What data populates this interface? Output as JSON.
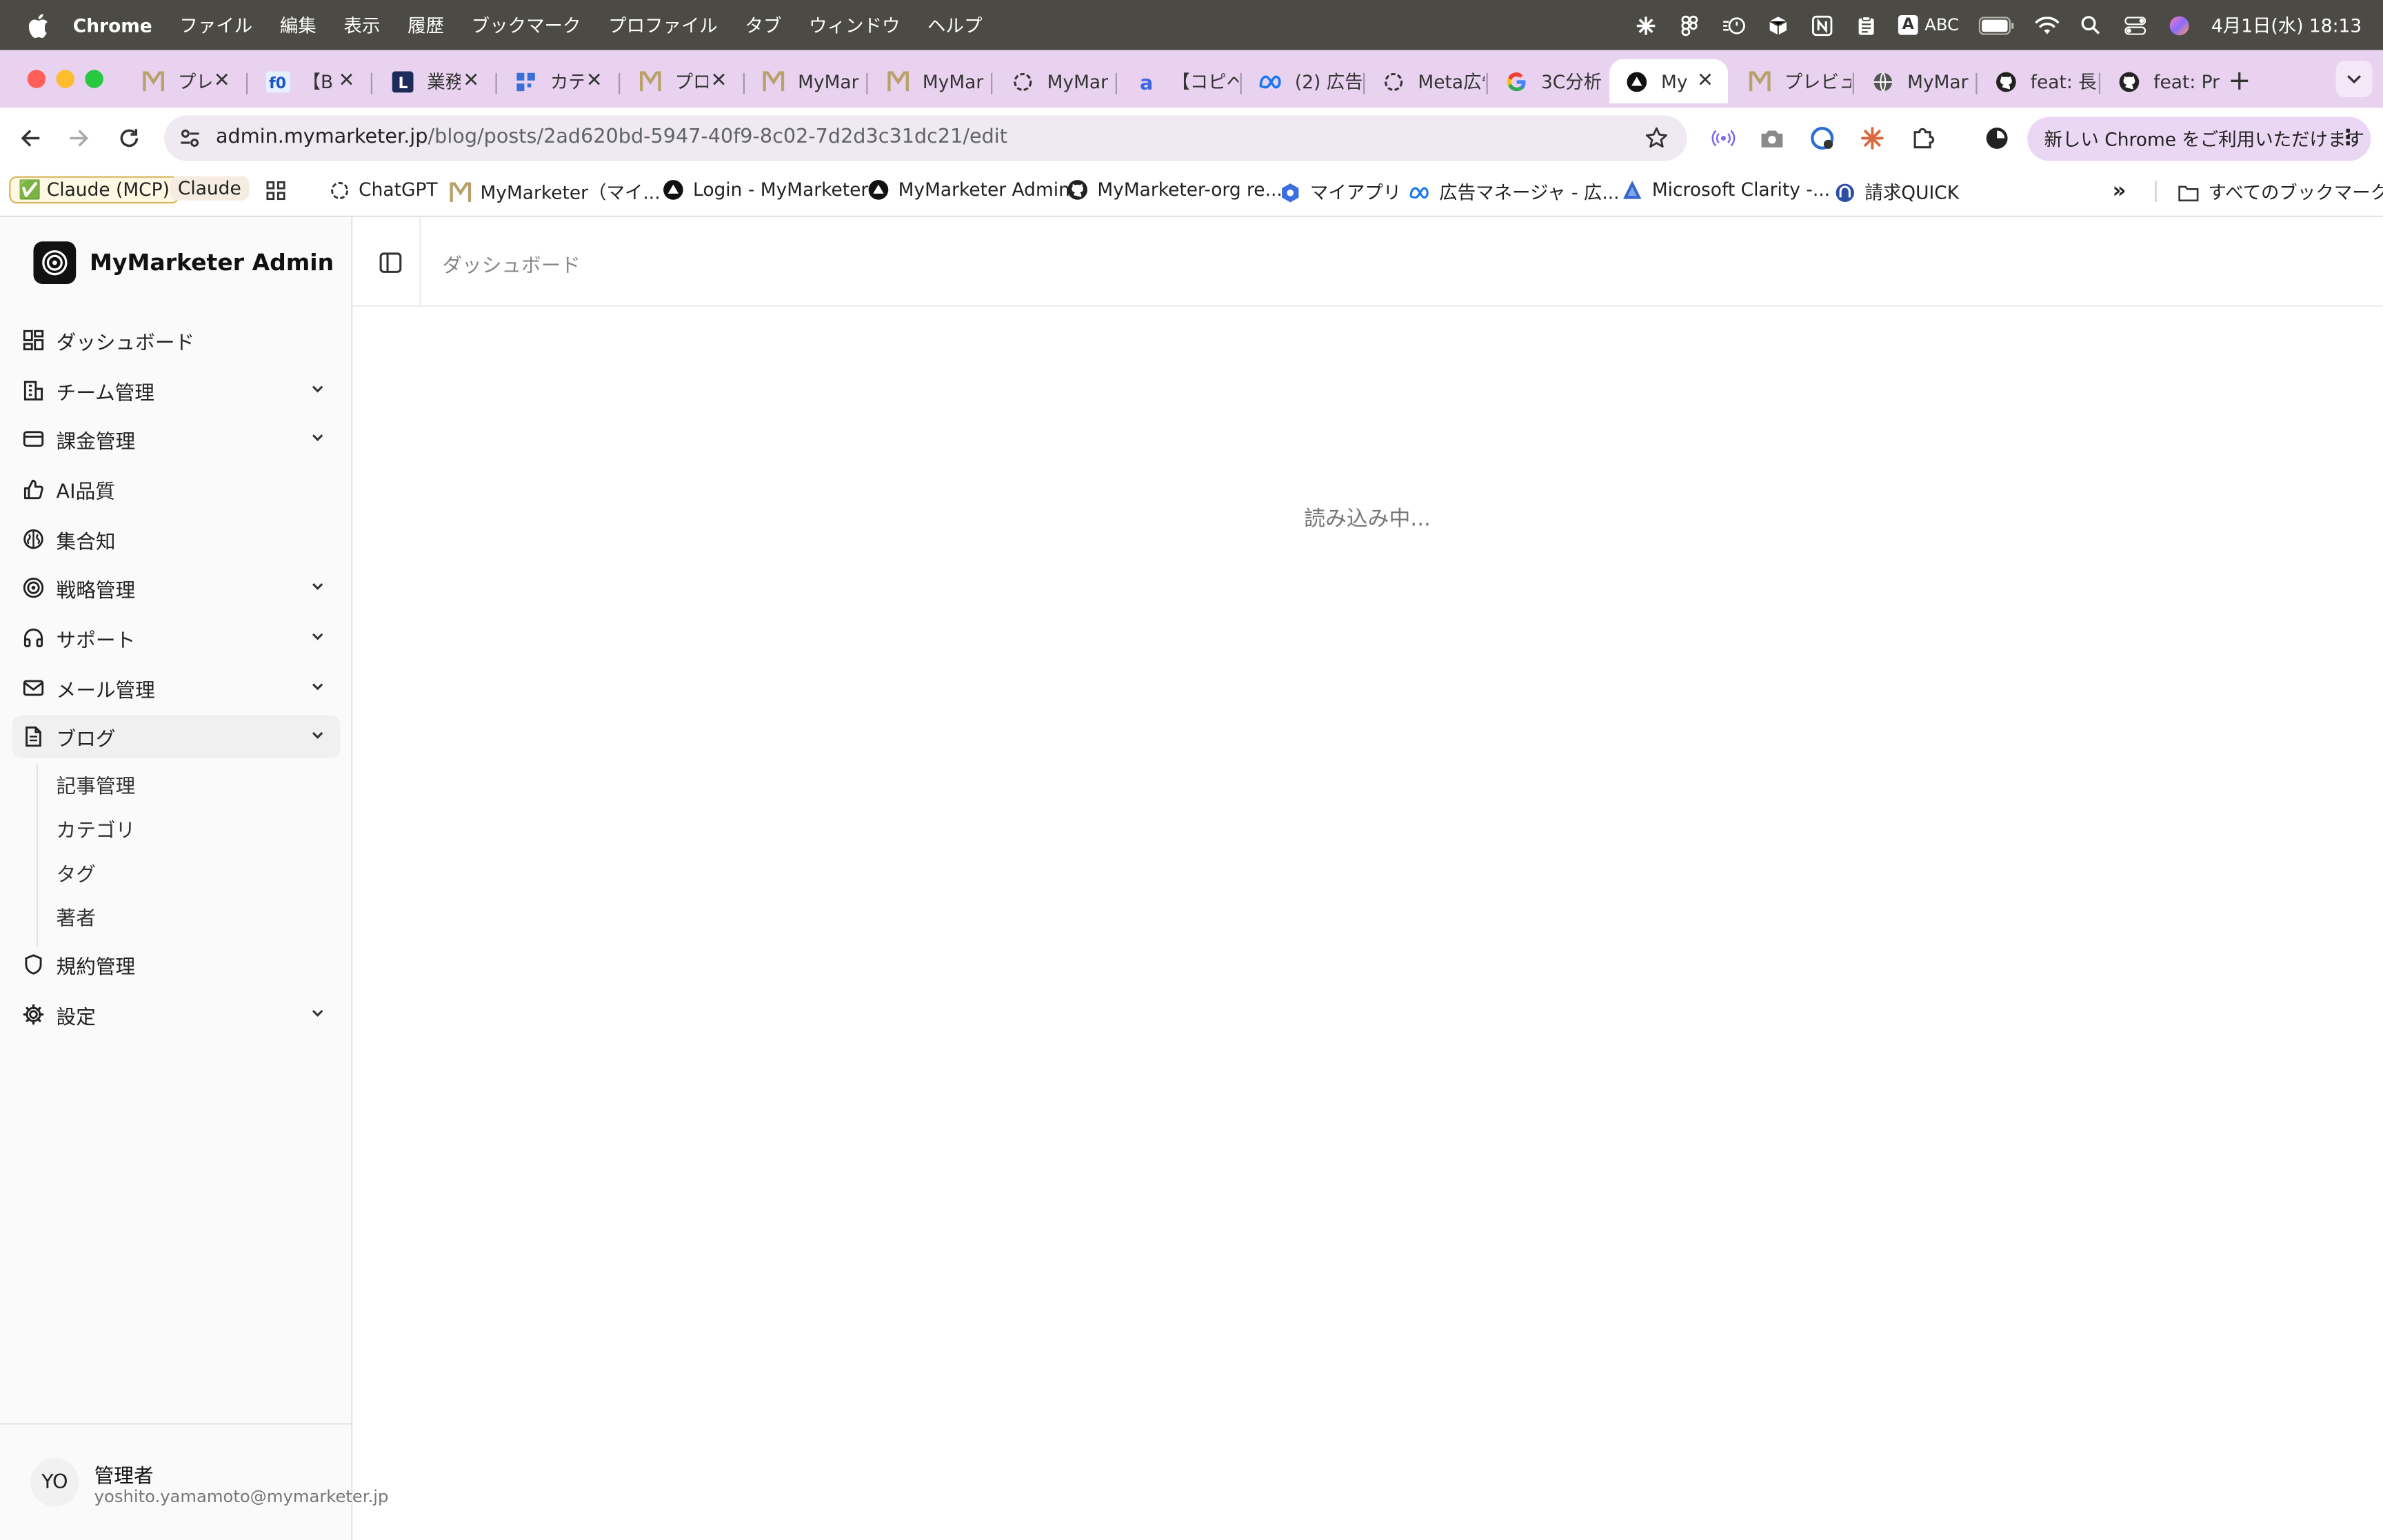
{
  "menubar": {
    "app": "Chrome",
    "items": [
      "ファイル",
      "編集",
      "表示",
      "履歴",
      "ブックマーク",
      "プロファイル",
      "タブ",
      "ウィンドウ",
      "ヘルプ"
    ],
    "input_abc": "ABC",
    "input_a": "A",
    "clock": "4月1日(水) 18:13"
  },
  "tabs": [
    {
      "title": "プレ",
      "icon": "mymarketer-logo-icon",
      "closable": true
    },
    {
      "title": "【B",
      "icon": "f-logo-icon",
      "closable": true
    },
    {
      "title": "業務",
      "icon": "l-logo-icon",
      "closable": true
    },
    {
      "title": "カテ",
      "icon": "grid-logo-icon",
      "closable": true
    },
    {
      "title": "プロ",
      "icon": "mymarketer-logo-icon",
      "closable": true
    },
    {
      "title": "MyMar",
      "icon": "mymarketer-logo-icon",
      "closable": false
    },
    {
      "title": "MyMar",
      "icon": "mymarketer-logo-icon",
      "closable": false
    },
    {
      "title": "MyMar",
      "icon": "openai-icon",
      "closable": false
    },
    {
      "title": "【コピペ",
      "icon": "a-logo-icon",
      "closable": false
    },
    {
      "title": "(2) 広告",
      "icon": "meta-icon",
      "closable": false
    },
    {
      "title": "Meta広告",
      "icon": "openai-icon",
      "closable": false
    },
    {
      "title": "3C分析",
      "icon": "google-icon",
      "closable": false
    },
    {
      "title": "My",
      "icon": "vercel-icon",
      "closable": true,
      "active": true
    },
    {
      "title": "プレビュ",
      "icon": "mymarketer-logo-icon",
      "closable": false
    },
    {
      "title": "MyMar",
      "icon": "globe-icon",
      "closable": false
    },
    {
      "title": "feat: 長",
      "icon": "github-icon",
      "closable": false
    },
    {
      "title": "feat: Pr",
      "icon": "github-icon",
      "closable": false
    }
  ],
  "address": {
    "host": "admin.mymarketer.jp",
    "path": "/blog/posts/2ad620bd-5947-40f9-8c02-7d2d3c31dc21/edit"
  },
  "chrome_update": "新しい Chrome をご利用いただけます",
  "bookmarks": [
    {
      "label": "✅ Claude (MCP)",
      "icon": ""
    },
    {
      "label": "Claude",
      "icon": ""
    },
    {
      "label": "",
      "icon": "apps-grid-icon"
    },
    {
      "label": "ChatGPT",
      "icon": "openai-icon"
    },
    {
      "label": "MyMarketer（マイ...",
      "icon": "mymarketer-logo-icon"
    },
    {
      "label": "Login - MyMarketer",
      "icon": "vercel-icon"
    },
    {
      "label": "MyMarketer Admin",
      "icon": "vercel-icon"
    },
    {
      "label": "MyMarketer-org re...",
      "icon": "github-icon"
    },
    {
      "label": "マイアプリ",
      "icon": "hex-icon"
    },
    {
      "label": "広告マネージャ - 広...",
      "icon": "meta-icon"
    },
    {
      "label": "Microsoft Clarity -...",
      "icon": "clarity-icon"
    },
    {
      "label": "請求QUICK",
      "icon": "quick-icon"
    }
  ],
  "bookmarks_all": "すべてのブックマーク",
  "brand": "MyMarketer Admin",
  "nav": [
    {
      "label": "ダッシュボード",
      "icon": "dashboard-icon",
      "expandable": false
    },
    {
      "label": "チーム管理",
      "icon": "building-icon",
      "expandable": true
    },
    {
      "label": "課金管理",
      "icon": "credit-card-icon",
      "expandable": true
    },
    {
      "label": "AI品質",
      "icon": "thumbs-up-icon",
      "expandable": false
    },
    {
      "label": "集合知",
      "icon": "brain-icon",
      "expandable": false
    },
    {
      "label": "戦略管理",
      "icon": "target-icon",
      "expandable": true
    },
    {
      "label": "サポート",
      "icon": "headphones-icon",
      "expandable": true
    },
    {
      "label": "メール管理",
      "icon": "mail-icon",
      "expandable": true
    },
    {
      "label": "ブログ",
      "icon": "file-text-icon",
      "expandable": true,
      "open": true
    },
    {
      "label": "規約管理",
      "icon": "shield-icon",
      "expandable": false
    },
    {
      "label": "設定",
      "icon": "gear-icon",
      "expandable": true
    }
  ],
  "blog_sub": [
    "記事管理",
    "カテゴリ",
    "タグ",
    "著者"
  ],
  "user": {
    "initials": "YO",
    "name": "管理者",
    "email": "yoshito.yamamoto@mymarketer.jp"
  },
  "header": {
    "breadcrumb": "ダッシュボード"
  },
  "main": {
    "loading": "読み込み中..."
  }
}
